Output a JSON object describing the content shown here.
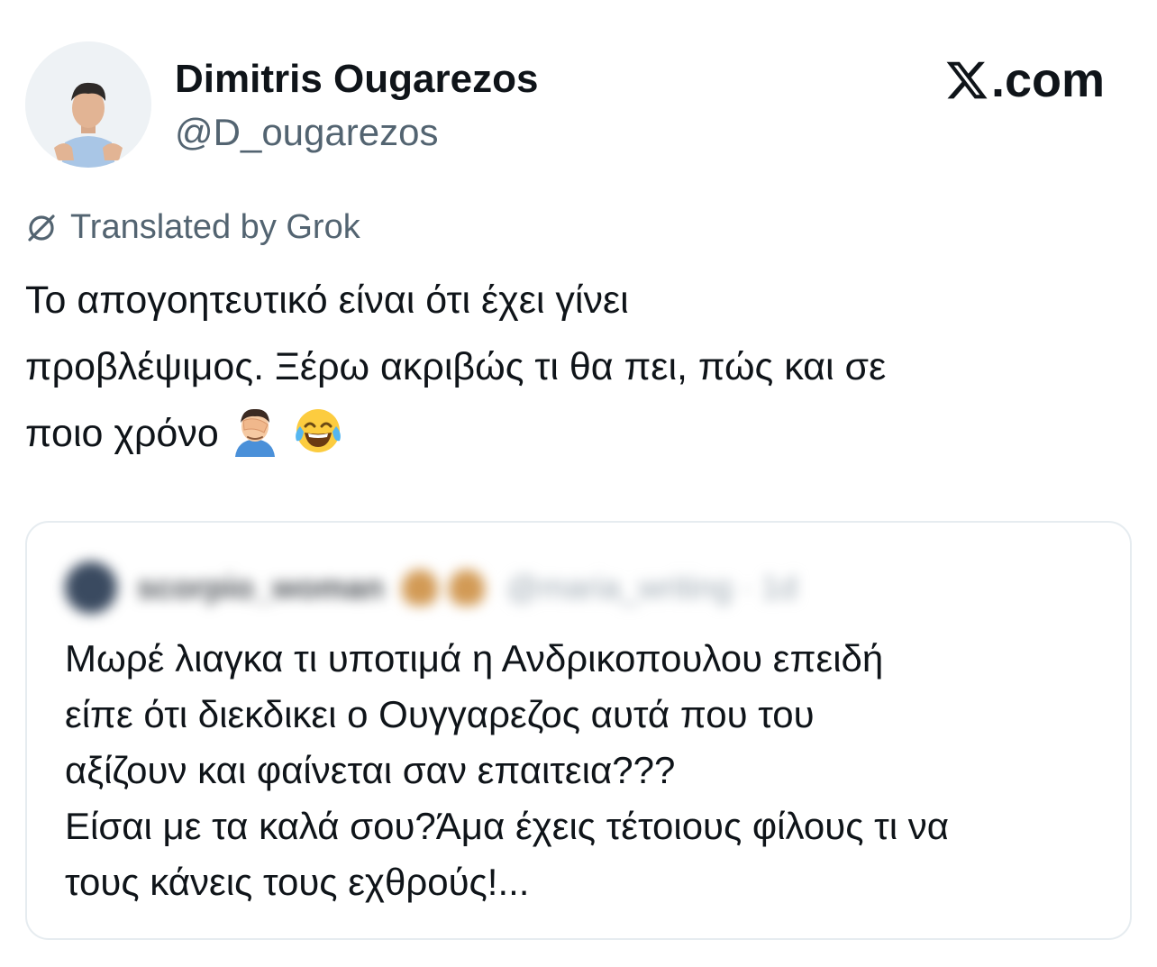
{
  "author": {
    "display_name": "Dimitris Ougarezos",
    "handle": "@D_ougarezos"
  },
  "brand": {
    "label": ".com",
    "icon": "x-logo-icon"
  },
  "translation": {
    "label": "Translated by Grok",
    "icon": "grok-icon"
  },
  "tweet": {
    "text": "Το απογοητευτικό είναι ότι έχει γίνει\nπροβλέψιμος. Ξέρω ακριβώς τι θα πει, πώς και σε\nποιο χρόνο",
    "emojis": [
      "facepalm-emoji",
      "tears-of-joy-emoji"
    ]
  },
  "quoted_tweet": {
    "display_name": "scorpio_woman",
    "handle": "@maria_writing · 1d",
    "text": "Μωρέ λιαγκα τι υποτιμά η Ανδρικοπουλου επειδή\nείπε ότι διεκδικει ο Ουγγαρεζος αυτά που του\nαξίζουν και φαίνεται σαν επαιτεια???\nΕίσαι με τα καλά σου?Άμα έχεις τέτοιους φίλους τι να\nτους κάνεις τους εχθρούς!..."
  }
}
